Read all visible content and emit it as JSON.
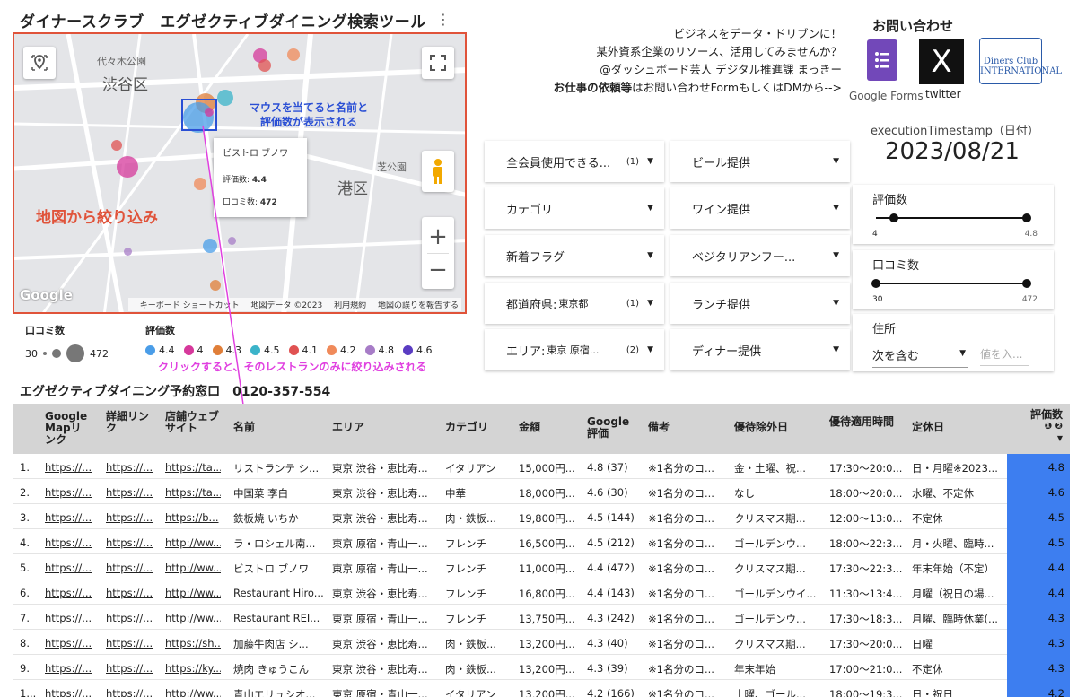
{
  "title": "ダイナースクラブ　エグゼクティブダイニング検索ツール",
  "title_menu": "⋮",
  "map": {
    "labels": {
      "shibuya": "渋谷区",
      "minato": "港区",
      "yoyogi": "代々木公園",
      "shiba": "芝公園"
    },
    "callout": "地図から絞り込み",
    "hover_note_1": "マウスを当てると名前と",
    "hover_note_2": "評価数が表示される",
    "tooltip": {
      "name": "ビストロ ブノワ",
      "rating_label": "評価数:",
      "rating_value": "4.4",
      "reviews_label": "口コミ数:",
      "reviews_value": "472"
    },
    "google": "Google",
    "footer": {
      "shortcut": "キーボード ショートカット",
      "data": "地図データ ©2023",
      "terms": "利用規約",
      "report": "地図の誤りを報告する"
    },
    "zoom_in": "+",
    "zoom_out": "−"
  },
  "legend": {
    "size_label": "口コミ数",
    "size_min": "30",
    "size_max": "472",
    "rating_label": "評価数",
    "ratings": [
      {
        "label": "4.4",
        "color": "#4a9de8"
      },
      {
        "label": "4",
        "color": "#d6389b"
      },
      {
        "label": "4.3",
        "color": "#e07e38"
      },
      {
        "label": "4.5",
        "color": "#3bb3c9"
      },
      {
        "label": "4.1",
        "color": "#e05252"
      },
      {
        "label": "4.2",
        "color": "#f08a5a"
      },
      {
        "label": "4.8",
        "color": "#a77cc7"
      },
      {
        "label": "4.6",
        "color": "#5a3cc2"
      }
    ]
  },
  "click_note": "クリックすると、そのレストランのみに絞り込みされる",
  "reserve": "エグゼクティブダイニング予約窓口　0120-357-554",
  "promo": {
    "line1": "ビジネスをデータ・ドリブンに！",
    "line2": "某外資系企業のリソース、活用してみませんか？",
    "line3": "@ダッシュボード芸人 デジタル推進課 まっきー",
    "line4_bold": "お仕事の依頼等",
    "line4_rest": "はお問い合わせFormもしくはDMから-->"
  },
  "contact": {
    "title": "お問い合わせ",
    "forms_label": "Google Forms",
    "x_label": "twitter",
    "x_glyph": "X",
    "diners_label": "Diners Club INTERNATIONAL"
  },
  "execution": {
    "label": "executionTimestamp（日付）",
    "date": "2023/08/21"
  },
  "filters_left": [
    {
      "label": "全会員使用できる...",
      "selected": "",
      "count": "(1)"
    },
    {
      "label": "カテゴリ",
      "selected": "",
      "count": ""
    },
    {
      "label": "新着フラグ",
      "selected": "",
      "count": ""
    },
    {
      "label": "都道府県:",
      "selected": "東京都",
      "count": "(1)"
    },
    {
      "label": "エリア:",
      "selected": "東京 原宿...",
      "count": "(2)"
    }
  ],
  "filters_right": [
    {
      "label": "ビール提供"
    },
    {
      "label": "ワイン提供"
    },
    {
      "label": "ベジタリアンフー..."
    },
    {
      "label": "ランチ提供"
    },
    {
      "label": "ディナー提供"
    }
  ],
  "sliders": {
    "rating": {
      "title": "評価数",
      "min": "4",
      "max": "4.8",
      "low": 0.12,
      "high": 1.0
    },
    "reviews": {
      "title": "口コミ数",
      "min": "30",
      "max": "472",
      "low": 0.0,
      "high": 1.0
    }
  },
  "address": {
    "title": "住所",
    "operator": "次を含む",
    "placeholder": "値を入..."
  },
  "table": {
    "headers": {
      "map_link": "Google Mapリンク",
      "detail_link": "詳細リンク",
      "website": "店舗ウェブサイト",
      "name": "名前",
      "area": "エリア",
      "category": "カテゴリ",
      "price": "金額",
      "google_rating": "Google 評価",
      "notes": "備考",
      "excluded_days": "優待除外日",
      "hours": "優待適用時間",
      "closed": "定休日",
      "rating": "評価数",
      "sort_marks": "❶ ❷"
    },
    "rows": [
      {
        "no": "1.",
        "map": "https://...",
        "detail": "https://...",
        "web": "https://ta...",
        "name": "リストランテ シ...",
        "area": "東京 渋谷・恵比寿...",
        "cat": "イタリアン",
        "price": "15,000円...",
        "g": "4.8 (37)",
        "note": "※1名分のコ...",
        "ex": "金・土曜、祝...",
        "hours": "17:30〜20:0...",
        "closed": "日・月曜※2023...",
        "rating": "4.8"
      },
      {
        "no": "2.",
        "map": "https://...",
        "detail": "https://...",
        "web": "https://ta...",
        "name": "中国菜 李白",
        "area": "東京 渋谷・恵比寿...",
        "cat": "中華",
        "price": "18,000円...",
        "g": "4.6 (30)",
        "note": "※1名分のコ...",
        "ex": "なし",
        "hours": "18:00〜20:0...",
        "closed": "水曜、不定休",
        "rating": "4.6"
      },
      {
        "no": "3.",
        "map": "https://...",
        "detail": "https://...",
        "web": "https://b...",
        "name": "鉄板焼 いちか",
        "area": "東京 渋谷・恵比寿...",
        "cat": "肉・鉄板...",
        "price": "19,800円...",
        "g": "4.5 (144)",
        "note": "※1名分のコ...",
        "ex": "クリスマス期...",
        "hours": "12:00〜13:0...",
        "closed": "不定休",
        "rating": "4.5"
      },
      {
        "no": "4.",
        "map": "https://...",
        "detail": "https://...",
        "web": "http://ww...",
        "name": "ラ・ロシェル南...",
        "area": "東京 原宿・青山一...",
        "cat": "フレンチ",
        "price": "16,500円...",
        "g": "4.5 (212)",
        "note": "※1名分のコ...",
        "ex": "ゴールデンウ...",
        "hours": "18:00〜22:3...",
        "closed": "月・火曜、臨時...",
        "rating": "4.5"
      },
      {
        "no": "5.",
        "map": "https://...",
        "detail": "https://...",
        "web": "http://ww...",
        "name": "ビストロ ブノワ",
        "area": "東京 原宿・青山一...",
        "cat": "フレンチ",
        "price": "11,000円...",
        "g": "4.4 (472)",
        "note": "※1名分のコ...",
        "ex": "クリスマス期...",
        "hours": "17:30〜22:3...",
        "closed": "年末年始（不定）",
        "rating": "4.4"
      },
      {
        "no": "6.",
        "map": "https://...",
        "detail": "https://...",
        "web": "http://ww...",
        "name": "Restaurant Hiro...",
        "area": "東京 渋谷・恵比寿...",
        "cat": "フレンチ",
        "price": "16,800円...",
        "g": "4.4 (143)",
        "note": "※1名分のコ...",
        "ex": "ゴールデンウイ...",
        "hours": "11:30〜13:4...",
        "closed": "月曜（祝日の場...",
        "rating": "4.4"
      },
      {
        "no": "7.",
        "map": "https://...",
        "detail": "https://...",
        "web": "http://ww...",
        "name": "Restaurant REI...",
        "area": "東京 原宿・青山一...",
        "cat": "フレンチ",
        "price": "13,750円...",
        "g": "4.3 (242)",
        "note": "※1名分のコ...",
        "ex": "ゴールデンウ...",
        "hours": "17:30〜18:3...",
        "closed": "月曜、臨時休業(...",
        "rating": "4.3"
      },
      {
        "no": "8.",
        "map": "https://...",
        "detail": "https://...",
        "web": "https://sh...",
        "name": "加藤牛肉店 シ...",
        "area": "東京 渋谷・恵比寿...",
        "cat": "肉・鉄板...",
        "price": "13,200円...",
        "g": "4.3 (40)",
        "note": "※1名分のコ...",
        "ex": "クリスマス期...",
        "hours": "17:30〜20:0...",
        "closed": "日曜",
        "rating": "4.3"
      },
      {
        "no": "9.",
        "map": "https://...",
        "detail": "https://...",
        "web": "https://ky...",
        "name": "焼肉 きゅうこん",
        "area": "東京 渋谷・恵比寿...",
        "cat": "肉・鉄板...",
        "price": "13,200円...",
        "g": "4.3 (39)",
        "note": "※1名分のコ...",
        "ex": "年末年始",
        "hours": "17:00〜21:0...",
        "closed": "不定休",
        "rating": "4.3"
      },
      {
        "no": "1...",
        "map": "https://...",
        "detail": "https://...",
        "web": "http://ww...",
        "name": "青山エリュシオ...",
        "area": "東京 原宿・青山一...",
        "cat": "イタリアン",
        "price": "13,200円...",
        "g": "4.2 (166)",
        "note": "※1名分のコ...",
        "ex": "土曜、ゴール...",
        "hours": "18:00〜19:3...",
        "closed": "日・祝日",
        "rating": "4.2"
      }
    ]
  }
}
